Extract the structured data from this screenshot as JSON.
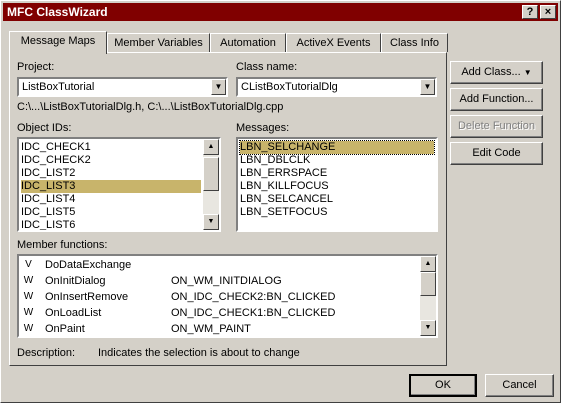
{
  "title": "MFC ClassWizard",
  "title_buttons": {
    "help": "?",
    "close": "×"
  },
  "tabs": [
    "Message Maps",
    "Member Variables",
    "Automation",
    "ActiveX Events",
    "Class Info"
  ],
  "project": {
    "label": "Project:",
    "value": "ListBoxTutorial"
  },
  "class_name": {
    "label": "Class name:",
    "value": "CListBoxTutorialDlg"
  },
  "files": "C:\\...\\ListBoxTutorialDlg.h, C:\\...\\ListBoxTutorialDlg.cpp",
  "object_ids": {
    "label": "Object IDs:",
    "items": [
      "IDC_CHECK1",
      "IDC_CHECK2",
      "IDC_LIST2",
      "IDC_LIST3",
      "IDC_LIST4",
      "IDC_LIST5",
      "IDC_LIST6"
    ],
    "selected": "IDC_LIST3"
  },
  "messages": {
    "label": "Messages:",
    "items": [
      "LBN_SELCHANGE",
      "LBN_DBLCLK",
      "LBN_ERRSPACE",
      "LBN_KILLFOCUS",
      "LBN_SELCANCEL",
      "LBN_SETFOCUS"
    ],
    "selected": "LBN_SELCHANGE"
  },
  "member_functions": {
    "label": "Member functions:",
    "rows": [
      {
        "type": "V",
        "name": "DoDataExchange",
        "handler": ""
      },
      {
        "type": "W",
        "name": "OnInitDialog",
        "handler": "ON_WM_INITDIALOG"
      },
      {
        "type": "W",
        "name": "OnInsertRemove",
        "handler": "ON_IDC_CHECK2:BN_CLICKED"
      },
      {
        "type": "W",
        "name": "OnLoadList",
        "handler": "ON_IDC_CHECK1:BN_CLICKED"
      },
      {
        "type": "W",
        "name": "OnPaint",
        "handler": "ON_WM_PAINT"
      }
    ]
  },
  "description": {
    "label": "Description:",
    "text": "Indicates the selection is about to change"
  },
  "buttons": {
    "add_class": "Add Class...",
    "add_function": "Add Function...",
    "delete_function": "Delete Function",
    "edit_code": "Edit Code",
    "ok": "OK",
    "cancel": "Cancel"
  }
}
